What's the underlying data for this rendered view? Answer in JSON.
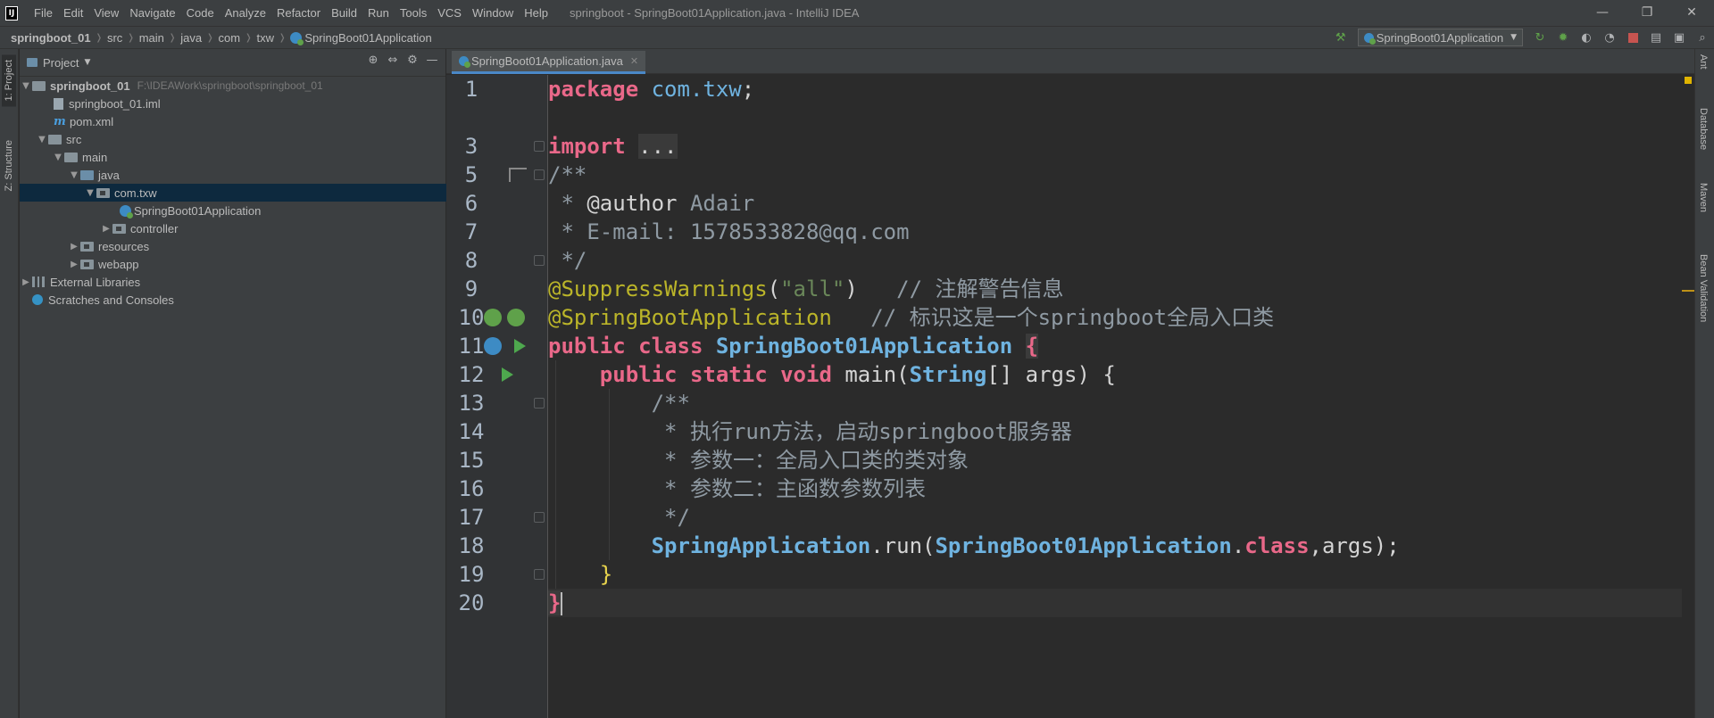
{
  "titlebar": {
    "logo": "IJ",
    "menu": [
      "File",
      "Edit",
      "View",
      "Navigate",
      "Code",
      "Analyze",
      "Refactor",
      "Build",
      "Run",
      "Tools",
      "VCS",
      "Window",
      "Help"
    ],
    "window_title": "springboot - SpringBoot01Application.java - IntelliJ IDEA",
    "controls": [
      "—",
      "❐",
      "✕"
    ]
  },
  "navbar": {
    "breadcrumbs": [
      "springboot_01",
      "src",
      "main",
      "java",
      "com",
      "txw",
      "SpringBoot01Application"
    ],
    "run_config": "SpringBoot01Application"
  },
  "left_strip": {
    "tabs": [
      "1: Project",
      "Z: Structure"
    ]
  },
  "right_strip": {
    "tabs": [
      "Ant",
      "Database",
      "Maven",
      "Bean Validation"
    ]
  },
  "project": {
    "title": "Project",
    "tree": [
      {
        "label": "springboot_01",
        "path": "F:\\IDEAWork\\springboot\\springboot_01"
      },
      {
        "label": "springboot_01.iml"
      },
      {
        "label": "pom.xml"
      },
      {
        "label": "src"
      },
      {
        "label": "main"
      },
      {
        "label": "java"
      },
      {
        "label": "com.txw"
      },
      {
        "label": "SpringBoot01Application"
      },
      {
        "label": "controller"
      },
      {
        "label": "resources"
      },
      {
        "label": "webapp"
      },
      {
        "label": "External Libraries"
      },
      {
        "label": "Scratches and Consoles"
      }
    ]
  },
  "editor": {
    "tab_label": "SpringBoot01Application.java",
    "line_numbers": [
      "1",
      "3",
      "5",
      "6",
      "7",
      "8",
      "9",
      "10",
      "11",
      "12",
      "13",
      "14",
      "15",
      "16",
      "17",
      "18",
      "19",
      "20"
    ],
    "lines": {
      "l1": {
        "k": "package",
        "p": "com.txw",
        "e": ";"
      },
      "l3": {
        "k": "import",
        "e": "..."
      },
      "l5": {
        "c": "/**"
      },
      "l6": {
        "c1": " * ",
        "a": "@author",
        "c2": " Adair"
      },
      "l7": {
        "c": " * E-mail: 1578533828@qq.com"
      },
      "l8": {
        "c": " */"
      },
      "l9": {
        "a": "@SuppressWarnings",
        "p1": "(",
        "s": "\"all\"",
        "p2": ")",
        "c": "   // 注解警告信息"
      },
      "l10": {
        "a": "@SpringBootApplication",
        "c": "   // 标识这是一个springboot全局入口类"
      },
      "l11": {
        "k1": "public",
        "k2": "class",
        "n": "SpringBoot01Application",
        "b": "{"
      },
      "l12": {
        "k1": "public",
        "k2": "static",
        "k3": "void",
        "m": "main",
        "p1": "(",
        "t": "String",
        "p2": "[] args) {"
      },
      "l13": {
        "c": "/**"
      },
      "l14": {
        "c": " * 执行run方法，启动springboot服务器"
      },
      "l15": {
        "c": " * 参数一：全局入口类的类对象"
      },
      "l16": {
        "c": " * 参数二：主函数参数列表"
      },
      "l17": {
        "c": " */"
      },
      "l18": {
        "t1": "SpringApplication",
        "p1": ".run(",
        "t2": "SpringBoot01Application",
        "p2": ".",
        "k": "class",
        "p3": ",args);"
      },
      "l19": {
        "b": "}"
      },
      "l20": {
        "b": "}"
      }
    }
  }
}
